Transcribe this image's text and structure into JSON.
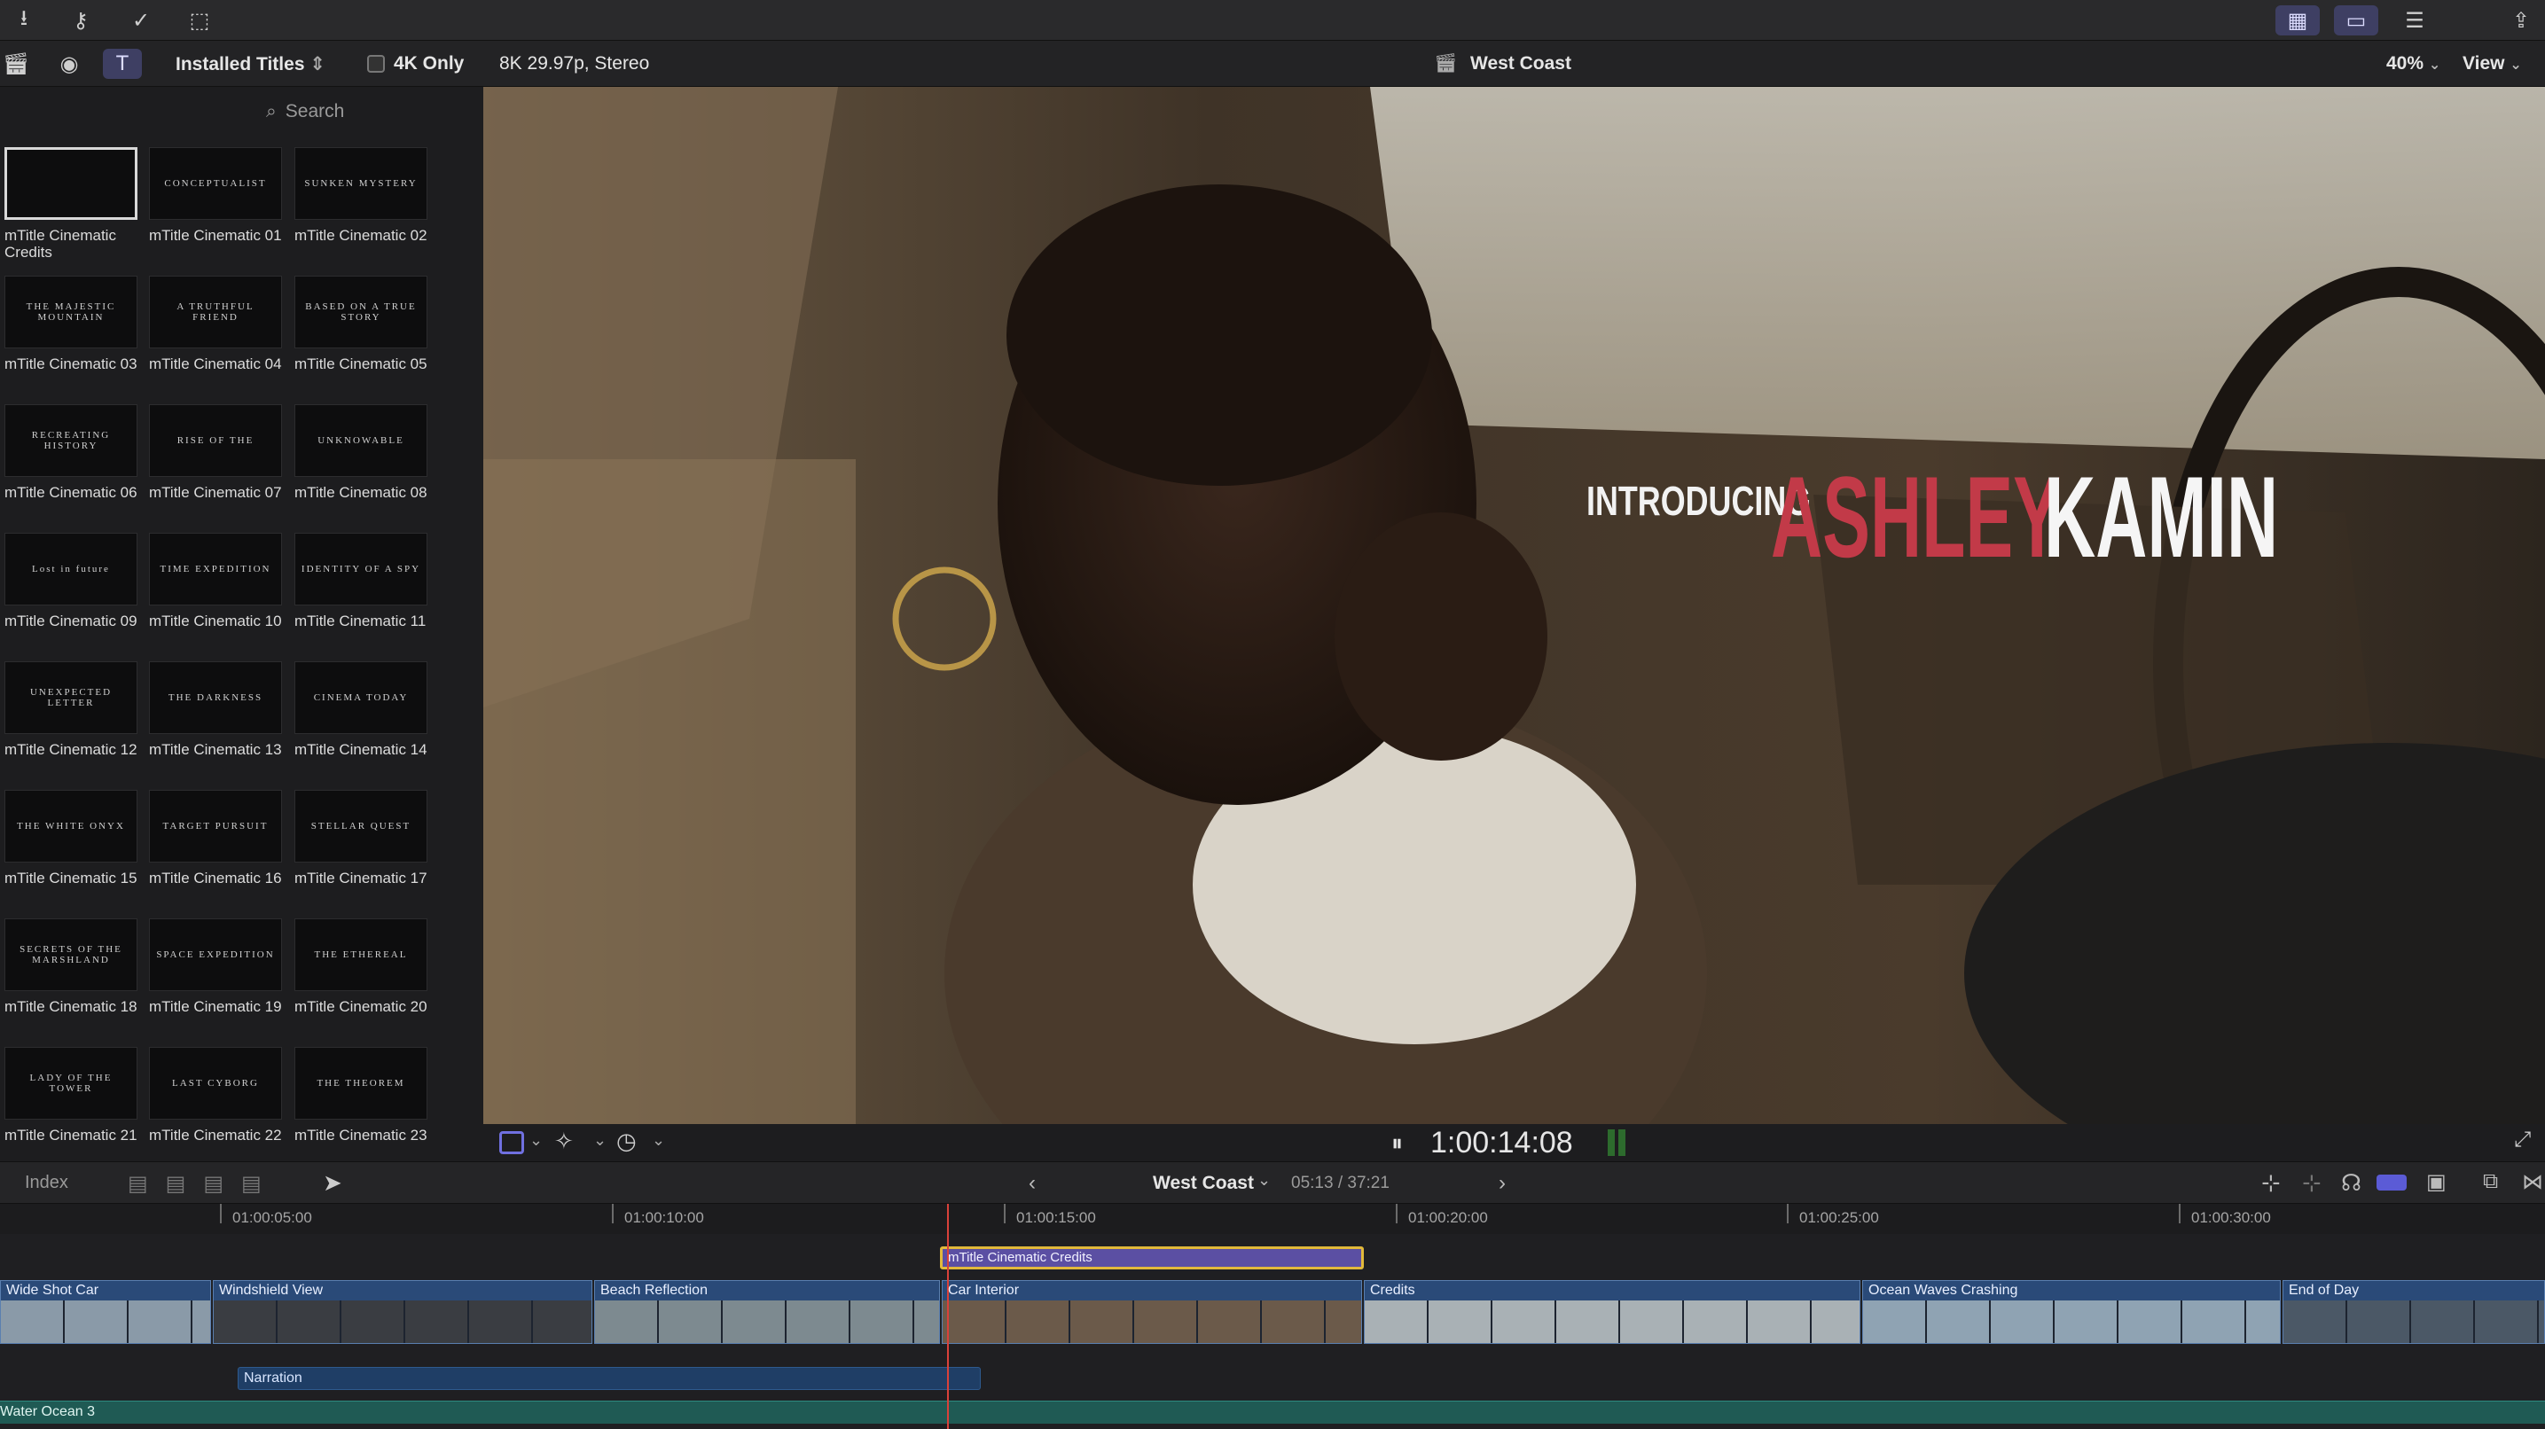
{
  "toolbar": {
    "left_icons": [
      "import-icon",
      "keyword-icon",
      "check-icon",
      "tag-icon"
    ],
    "right_icons": [
      "grid-icon",
      "filmstrip-icon",
      "inspector-icon",
      "share-icon"
    ]
  },
  "browser": {
    "library_icons": [
      "clapper-icon",
      "photos-icon",
      "titles-icon"
    ],
    "category": "Installed Titles",
    "filter_label": "4K Only",
    "search_placeholder": "Search",
    "tiles": [
      {
        "thumb": "",
        "name": "mTitle Cinematic Credits"
      },
      {
        "thumb": "CONCEPTUALIST",
        "name": "mTitle Cinematic 01"
      },
      {
        "thumb": "SUNKEN MYSTERY",
        "name": "mTitle Cinematic 02"
      },
      {
        "thumb": "THE MAJESTIC MOUNTAIN",
        "name": "mTitle Cinematic 03"
      },
      {
        "thumb": "A TRUTHFUL FRIEND",
        "name": "mTitle Cinematic 04"
      },
      {
        "thumb": "BASED ON A TRUE STORY",
        "name": "mTitle Cinematic 05"
      },
      {
        "thumb": "RECREATING HISTORY",
        "name": "mTitle Cinematic 06"
      },
      {
        "thumb": "RISE OF THE",
        "name": "mTitle Cinematic 07"
      },
      {
        "thumb": "UNKNOWABLE",
        "name": "mTitle Cinematic 08"
      },
      {
        "thumb": "Lost in future",
        "name": "mTitle Cinematic 09"
      },
      {
        "thumb": "TIME EXPEDITION",
        "name": "mTitle Cinematic 10"
      },
      {
        "thumb": "IDENTITY OF A SPY",
        "name": "mTitle Cinematic 11"
      },
      {
        "thumb": "UNEXPECTED LETTER",
        "name": "mTitle Cinematic 12"
      },
      {
        "thumb": "THE DARKNESS",
        "name": "mTitle Cinematic 13"
      },
      {
        "thumb": "CINEMA TODAY",
        "name": "mTitle Cinematic 14"
      },
      {
        "thumb": "THE WHITE ONYX",
        "name": "mTitle Cinematic 15"
      },
      {
        "thumb": "TARGET PURSUIT",
        "name": "mTitle Cinematic 16"
      },
      {
        "thumb": "STELLAR QUEST",
        "name": "mTitle Cinematic 17"
      },
      {
        "thumb": "SECRETS OF THE MARSHLAND",
        "name": "mTitle Cinematic 18"
      },
      {
        "thumb": "SPACE EXPEDITION",
        "name": "mTitle Cinematic 19"
      },
      {
        "thumb": "THE ETHEREAL",
        "name": "mTitle Cinematic 20"
      },
      {
        "thumb": "LADY OF THE TOWER",
        "name": "mTitle Cinematic 21"
      },
      {
        "thumb": "LAST CYBORG",
        "name": "mTitle Cinematic 22"
      },
      {
        "thumb": "THE THEOREM",
        "name": "mTitle Cinematic 23"
      }
    ]
  },
  "viewer": {
    "format": "8K 29.97p, Stereo",
    "project": "West Coast",
    "zoom": "40%",
    "view_label": "View",
    "title_intro": "INTRODUCING",
    "title_first": "ASHLEY",
    "title_last": "KAMIN",
    "title_first_color": "#c23a48",
    "timecode": "1:00:14:08"
  },
  "timeline": {
    "index_label": "Index",
    "project": "West Coast",
    "position": "05:13 / 37:21",
    "ruler": [
      "01:00:05:00",
      "01:00:10:00",
      "01:00:15:00",
      "01:00:20:00",
      "01:00:25:00",
      "01:00:30:00"
    ],
    "title_clip": "mTitle Cinematic Credits",
    "clips": [
      "Wide Shot Car",
      "Windshield View",
      "Beach Reflection",
      "Car Interior",
      "Credits",
      "Ocean Waves Crashing",
      "End of Day"
    ],
    "narration": "Narration",
    "music": "Water Ocean 3",
    "accent": "#5b5bd6"
  }
}
